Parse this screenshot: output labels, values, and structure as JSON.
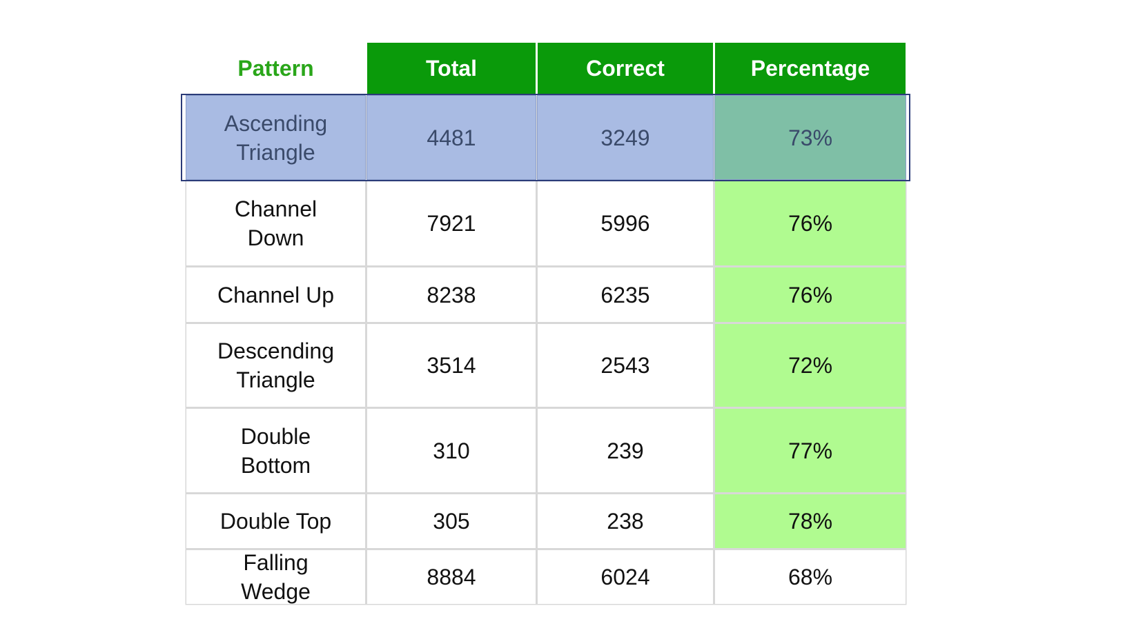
{
  "headers": [
    "Pattern",
    "Total",
    "Correct",
    "Percentage"
  ],
  "colors": {
    "header_bg": "#0a9a0a",
    "pattern_header_text": "#2aa61a",
    "highlight_green": "#b0fb90",
    "selected_row": "#a9bbe3"
  },
  "rows": [
    {
      "pattern": "Ascending Triangle",
      "total": "4481",
      "correct": "3249",
      "percentage": "73%",
      "highlighted": true,
      "selected": true
    },
    {
      "pattern": "Channel Down",
      "total": "7921",
      "correct": "5996",
      "percentage": "76%",
      "highlighted": true,
      "selected": false
    },
    {
      "pattern": "Channel Up",
      "total": "8238",
      "correct": "6235",
      "percentage": "76%",
      "highlighted": true,
      "selected": false
    },
    {
      "pattern": "Descending Triangle",
      "total": "3514",
      "correct": "2543",
      "percentage": "72%",
      "highlighted": true,
      "selected": false
    },
    {
      "pattern": "Double Bottom",
      "total": "310",
      "correct": "239",
      "percentage": "77%",
      "highlighted": true,
      "selected": false
    },
    {
      "pattern": "Double Top",
      "total": "305",
      "correct": "238",
      "percentage": "78%",
      "highlighted": true,
      "selected": false
    },
    {
      "pattern": "Falling Wedge",
      "total": "8884",
      "correct": "6024",
      "percentage": "68%",
      "highlighted": false,
      "selected": false
    }
  ]
}
